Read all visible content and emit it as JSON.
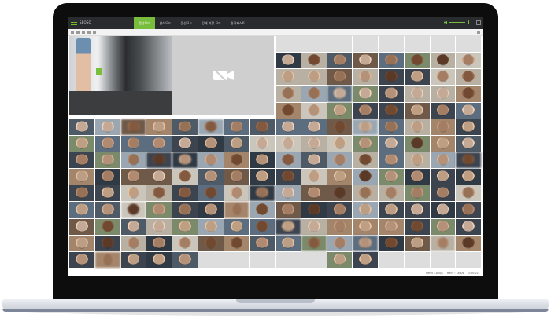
{
  "app": {
    "brand": "SEOSO"
  },
  "nav": {
    "tabs": [
      {
        "label": "정상모드",
        "active": true
      },
      {
        "label": "분석모드",
        "active": false
      },
      {
        "label": "음성모드",
        "active": false
      },
      {
        "label": "강제 퇴장 모드",
        "active": false
      },
      {
        "label": "원격제스트",
        "active": false
      }
    ]
  },
  "colors": {
    "accent": "#79bd3d",
    "topbar": "#2a2b2e"
  },
  "icons": {
    "menu": "hamburger-menu-icon",
    "volume": "speaker-icon",
    "mic": "microphone-icon",
    "no_video": "camera-off-icon"
  },
  "status": {
    "left": "Send : 1kB/s",
    "middle": "Recv : 1kB/s",
    "right": "0:00:21"
  },
  "grid": {
    "cols": 16,
    "rows": 14,
    "featured": [
      "live-video",
      "no-video"
    ]
  }
}
